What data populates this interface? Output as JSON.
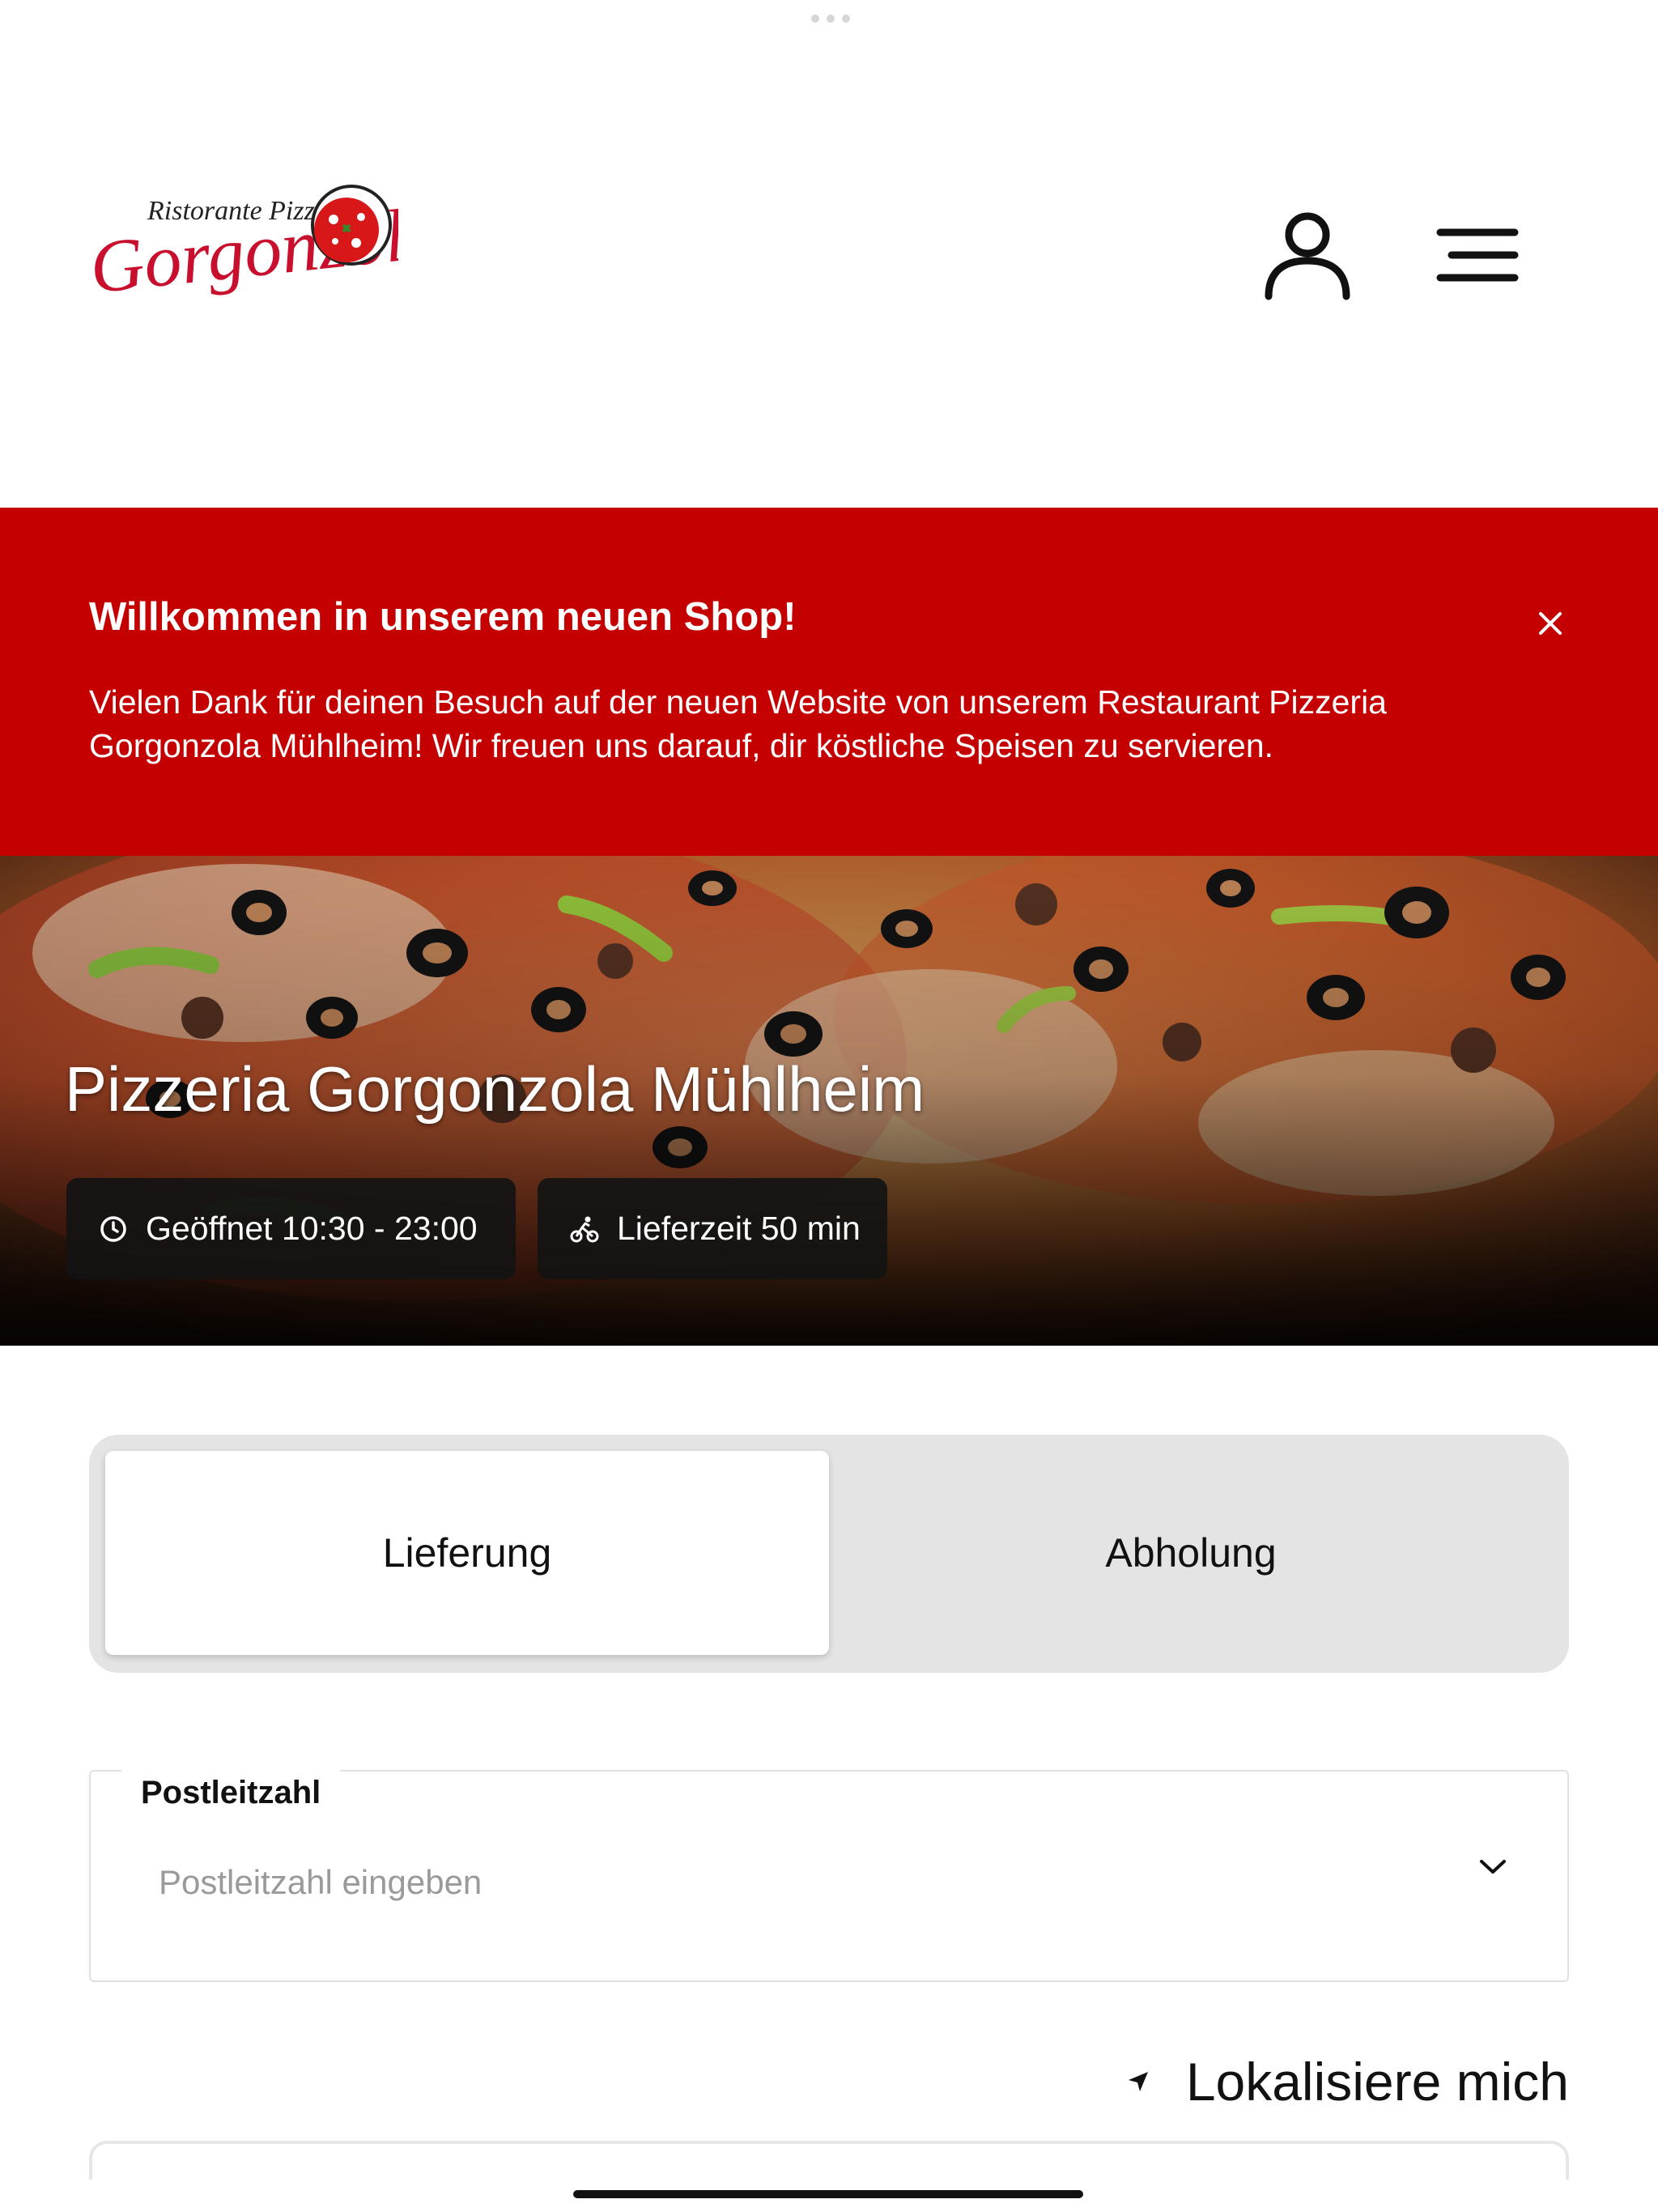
{
  "header": {
    "logo": {
      "line1": "Ristorante Pizzeria",
      "line2": "Gorgonzola"
    },
    "user_icon": "user-icon",
    "menu_icon": "hamburger-menu-icon"
  },
  "banner": {
    "title": "Willkommen in unserem neuen Shop!",
    "text": "Vielen Dank für deinen Besuch auf der neuen Website von unserem Restaurant Pizzeria Gorgonzola Mühlheim! Wir freuen uns darauf, dir köstliche Speisen zu servieren.",
    "close_icon": "close-icon",
    "background_color": "#c40000"
  },
  "hero": {
    "title": "Pizzeria Gorgonzola Mühlheim",
    "opening_hours": "Geöffnet 10:30 - 23:00",
    "delivery_time": "Lieferzeit 50 min",
    "opening_icon": "clock-icon",
    "delivery_icon": "cyclist-icon"
  },
  "order_mode": {
    "options": [
      "Lieferung",
      "Abholung"
    ],
    "selected": "Lieferung"
  },
  "postcode": {
    "label": "Postleitzahl",
    "placeholder": "Postleitzahl eingeben",
    "value": "",
    "dropdown_icon": "chevron-down-icon"
  },
  "locate": {
    "label": "Lokalisiere mich",
    "icon": "location-arrow-icon"
  }
}
